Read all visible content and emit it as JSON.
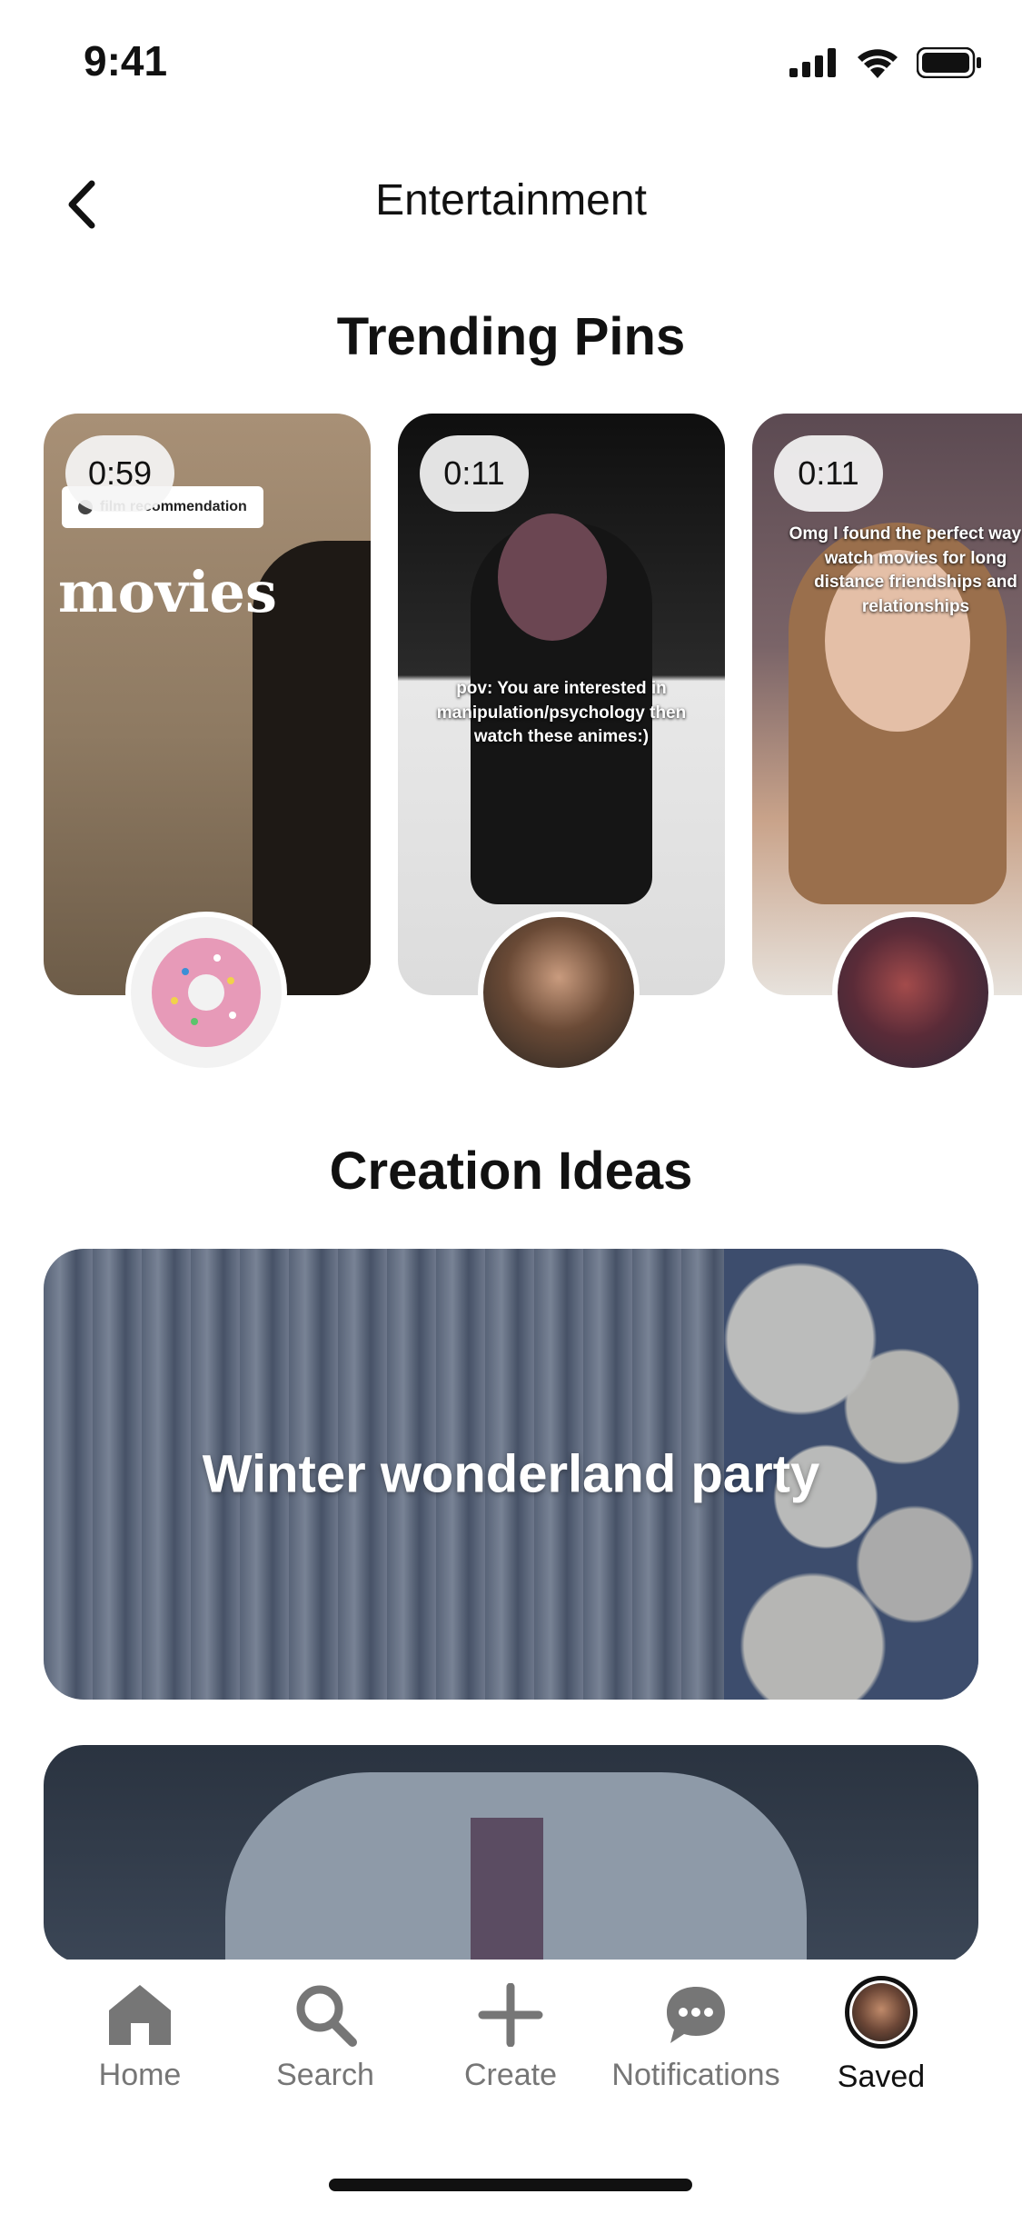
{
  "status_bar": {
    "time": "9:41"
  },
  "header": {
    "title": "Entertainment"
  },
  "sections": {
    "trending": "Trending Pins",
    "creation": "Creation Ideas"
  },
  "trending_pins": [
    {
      "duration": "0:59",
      "comment_tag": "film recommendation",
      "overlay_text": "movies"
    },
    {
      "duration": "0:11",
      "overlay_text": "pov: You are interested in manipulation/psychology then watch these animes:)"
    },
    {
      "duration": "0:11",
      "overlay_text": "Omg I found the perfect way to watch movies for long distance friendships and relationships"
    }
  ],
  "creation_ideas": [
    {
      "label": "Winter wonderland party"
    },
    {
      "label": ""
    }
  ],
  "bottom_nav": [
    {
      "label": "Home",
      "icon": "home-icon"
    },
    {
      "label": "Search",
      "icon": "search-icon"
    },
    {
      "label": "Create",
      "icon": "plus-icon"
    },
    {
      "label": "Notifications",
      "icon": "chat-bubble-icon"
    },
    {
      "label": "Saved",
      "icon": "profile-avatar",
      "active": true
    }
  ]
}
